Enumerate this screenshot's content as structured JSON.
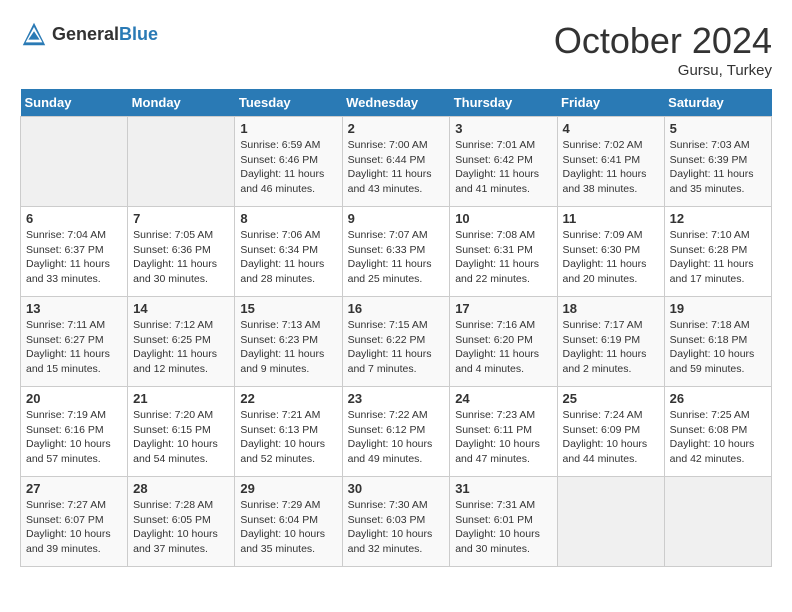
{
  "header": {
    "logo_general": "General",
    "logo_blue": "Blue",
    "month_title": "October 2024",
    "location": "Gursu, Turkey"
  },
  "weekdays": [
    "Sunday",
    "Monday",
    "Tuesday",
    "Wednesday",
    "Thursday",
    "Friday",
    "Saturday"
  ],
  "weeks": [
    [
      {
        "day": "",
        "info": ""
      },
      {
        "day": "",
        "info": ""
      },
      {
        "day": "1",
        "info": "Sunrise: 6:59 AM\nSunset: 6:46 PM\nDaylight: 11 hours and 46 minutes."
      },
      {
        "day": "2",
        "info": "Sunrise: 7:00 AM\nSunset: 6:44 PM\nDaylight: 11 hours and 43 minutes."
      },
      {
        "day": "3",
        "info": "Sunrise: 7:01 AM\nSunset: 6:42 PM\nDaylight: 11 hours and 41 minutes."
      },
      {
        "day": "4",
        "info": "Sunrise: 7:02 AM\nSunset: 6:41 PM\nDaylight: 11 hours and 38 minutes."
      },
      {
        "day": "5",
        "info": "Sunrise: 7:03 AM\nSunset: 6:39 PM\nDaylight: 11 hours and 35 minutes."
      }
    ],
    [
      {
        "day": "6",
        "info": "Sunrise: 7:04 AM\nSunset: 6:37 PM\nDaylight: 11 hours and 33 minutes."
      },
      {
        "day": "7",
        "info": "Sunrise: 7:05 AM\nSunset: 6:36 PM\nDaylight: 11 hours and 30 minutes."
      },
      {
        "day": "8",
        "info": "Sunrise: 7:06 AM\nSunset: 6:34 PM\nDaylight: 11 hours and 28 minutes."
      },
      {
        "day": "9",
        "info": "Sunrise: 7:07 AM\nSunset: 6:33 PM\nDaylight: 11 hours and 25 minutes."
      },
      {
        "day": "10",
        "info": "Sunrise: 7:08 AM\nSunset: 6:31 PM\nDaylight: 11 hours and 22 minutes."
      },
      {
        "day": "11",
        "info": "Sunrise: 7:09 AM\nSunset: 6:30 PM\nDaylight: 11 hours and 20 minutes."
      },
      {
        "day": "12",
        "info": "Sunrise: 7:10 AM\nSunset: 6:28 PM\nDaylight: 11 hours and 17 minutes."
      }
    ],
    [
      {
        "day": "13",
        "info": "Sunrise: 7:11 AM\nSunset: 6:27 PM\nDaylight: 11 hours and 15 minutes."
      },
      {
        "day": "14",
        "info": "Sunrise: 7:12 AM\nSunset: 6:25 PM\nDaylight: 11 hours and 12 minutes."
      },
      {
        "day": "15",
        "info": "Sunrise: 7:13 AM\nSunset: 6:23 PM\nDaylight: 11 hours and 9 minutes."
      },
      {
        "day": "16",
        "info": "Sunrise: 7:15 AM\nSunset: 6:22 PM\nDaylight: 11 hours and 7 minutes."
      },
      {
        "day": "17",
        "info": "Sunrise: 7:16 AM\nSunset: 6:20 PM\nDaylight: 11 hours and 4 minutes."
      },
      {
        "day": "18",
        "info": "Sunrise: 7:17 AM\nSunset: 6:19 PM\nDaylight: 11 hours and 2 minutes."
      },
      {
        "day": "19",
        "info": "Sunrise: 7:18 AM\nSunset: 6:18 PM\nDaylight: 10 hours and 59 minutes."
      }
    ],
    [
      {
        "day": "20",
        "info": "Sunrise: 7:19 AM\nSunset: 6:16 PM\nDaylight: 10 hours and 57 minutes."
      },
      {
        "day": "21",
        "info": "Sunrise: 7:20 AM\nSunset: 6:15 PM\nDaylight: 10 hours and 54 minutes."
      },
      {
        "day": "22",
        "info": "Sunrise: 7:21 AM\nSunset: 6:13 PM\nDaylight: 10 hours and 52 minutes."
      },
      {
        "day": "23",
        "info": "Sunrise: 7:22 AM\nSunset: 6:12 PM\nDaylight: 10 hours and 49 minutes."
      },
      {
        "day": "24",
        "info": "Sunrise: 7:23 AM\nSunset: 6:11 PM\nDaylight: 10 hours and 47 minutes."
      },
      {
        "day": "25",
        "info": "Sunrise: 7:24 AM\nSunset: 6:09 PM\nDaylight: 10 hours and 44 minutes."
      },
      {
        "day": "26",
        "info": "Sunrise: 7:25 AM\nSunset: 6:08 PM\nDaylight: 10 hours and 42 minutes."
      }
    ],
    [
      {
        "day": "27",
        "info": "Sunrise: 7:27 AM\nSunset: 6:07 PM\nDaylight: 10 hours and 39 minutes."
      },
      {
        "day": "28",
        "info": "Sunrise: 7:28 AM\nSunset: 6:05 PM\nDaylight: 10 hours and 37 minutes."
      },
      {
        "day": "29",
        "info": "Sunrise: 7:29 AM\nSunset: 6:04 PM\nDaylight: 10 hours and 35 minutes."
      },
      {
        "day": "30",
        "info": "Sunrise: 7:30 AM\nSunset: 6:03 PM\nDaylight: 10 hours and 32 minutes."
      },
      {
        "day": "31",
        "info": "Sunrise: 7:31 AM\nSunset: 6:01 PM\nDaylight: 10 hours and 30 minutes."
      },
      {
        "day": "",
        "info": ""
      },
      {
        "day": "",
        "info": ""
      }
    ]
  ],
  "colors": {
    "header_bg": "#2a7ab5",
    "logo_blue": "#2a7ab5"
  }
}
